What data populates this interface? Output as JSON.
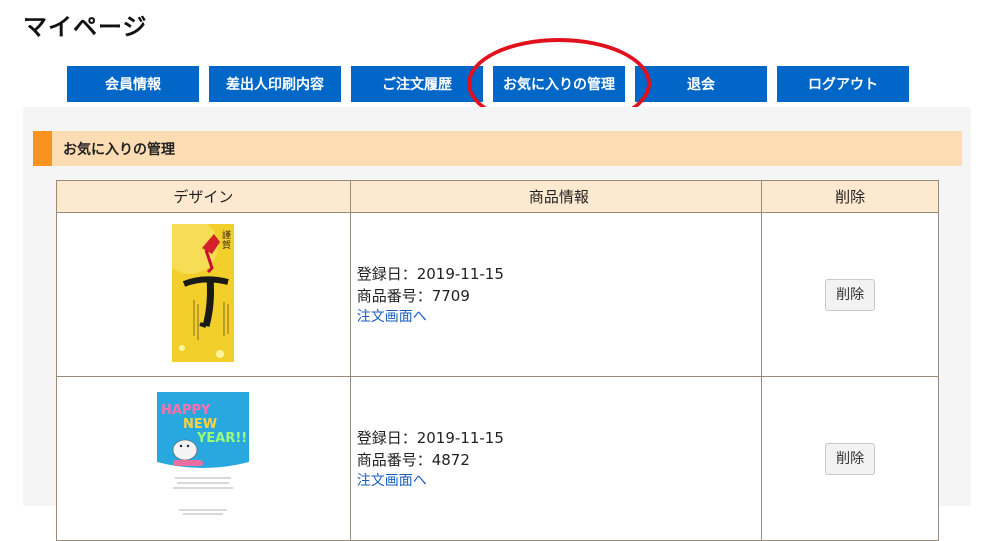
{
  "page": {
    "title": "マイページ"
  },
  "nav": {
    "items": [
      {
        "label": "会員情報"
      },
      {
        "label": "差出人印刷内容"
      },
      {
        "label": "ご注文履歴"
      },
      {
        "label": "お気に入りの管理"
      },
      {
        "label": "退会"
      },
      {
        "label": "ログアウト"
      }
    ],
    "accent": "#0066c8",
    "highlight_color": "#e0101c"
  },
  "section": {
    "title": "お気に入りの管理",
    "accent": "#f7931e",
    "bg": "#fcdcb2"
  },
  "table": {
    "headers": {
      "design": "デザイン",
      "info": "商品情報",
      "delete": "削除"
    },
    "rows": [
      {
        "design_icon": "new-year-card-yellow-thumbnail",
        "registered": "登録日：2019-11-15",
        "product_no": "商品番号：7709",
        "order_link": "注文画面へ",
        "delete_label": "削除"
      },
      {
        "design_icon": "new-year-card-blue-thumbnail",
        "registered": "登録日：2019-11-15",
        "product_no": "商品番号：4872",
        "order_link": "注文画面へ",
        "delete_label": "削除"
      }
    ]
  }
}
